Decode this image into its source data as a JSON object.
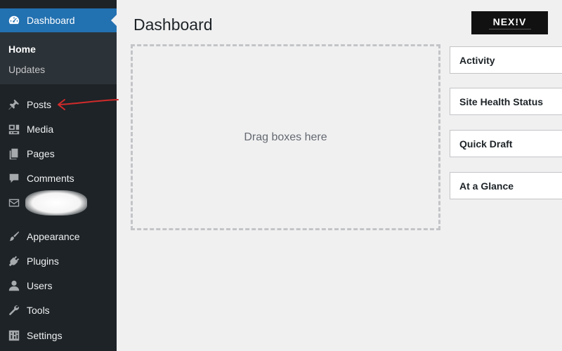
{
  "sidebar": {
    "dashboard": {
      "label": "Dashboard",
      "icon": "dashboard-gauge-icon"
    },
    "submenu": [
      {
        "label": "Home",
        "current": true
      },
      {
        "label": "Updates",
        "current": false
      }
    ],
    "items": [
      {
        "label": "Posts",
        "icon": "pin-icon"
      },
      {
        "label": "Media",
        "icon": "media-icon"
      },
      {
        "label": "Pages",
        "icon": "pages-icon"
      },
      {
        "label": "Comments",
        "icon": "comment-icon"
      },
      {
        "label": "",
        "icon": "mail-icon"
      },
      {
        "label": "Appearance",
        "icon": "brush-icon"
      },
      {
        "label": "Plugins",
        "icon": "plug-icon"
      },
      {
        "label": "Users",
        "icon": "user-icon"
      },
      {
        "label": "Tools",
        "icon": "wrench-icon"
      },
      {
        "label": "Settings",
        "icon": "settings-icon"
      }
    ]
  },
  "header": {
    "title": "Dashboard",
    "logo_text": "NEX!V"
  },
  "main": {
    "drop_zone_text": "Drag boxes here",
    "widgets": [
      {
        "title": "Activity"
      },
      {
        "title": "Site Health Status"
      },
      {
        "title": "Quick Draft"
      },
      {
        "title": "At a Glance"
      }
    ]
  },
  "colors": {
    "sidebar_bg": "#1d2327",
    "active_bg": "#2271b1",
    "page_bg": "#f0f0f1",
    "annotation_arrow": "#d12b2b"
  }
}
